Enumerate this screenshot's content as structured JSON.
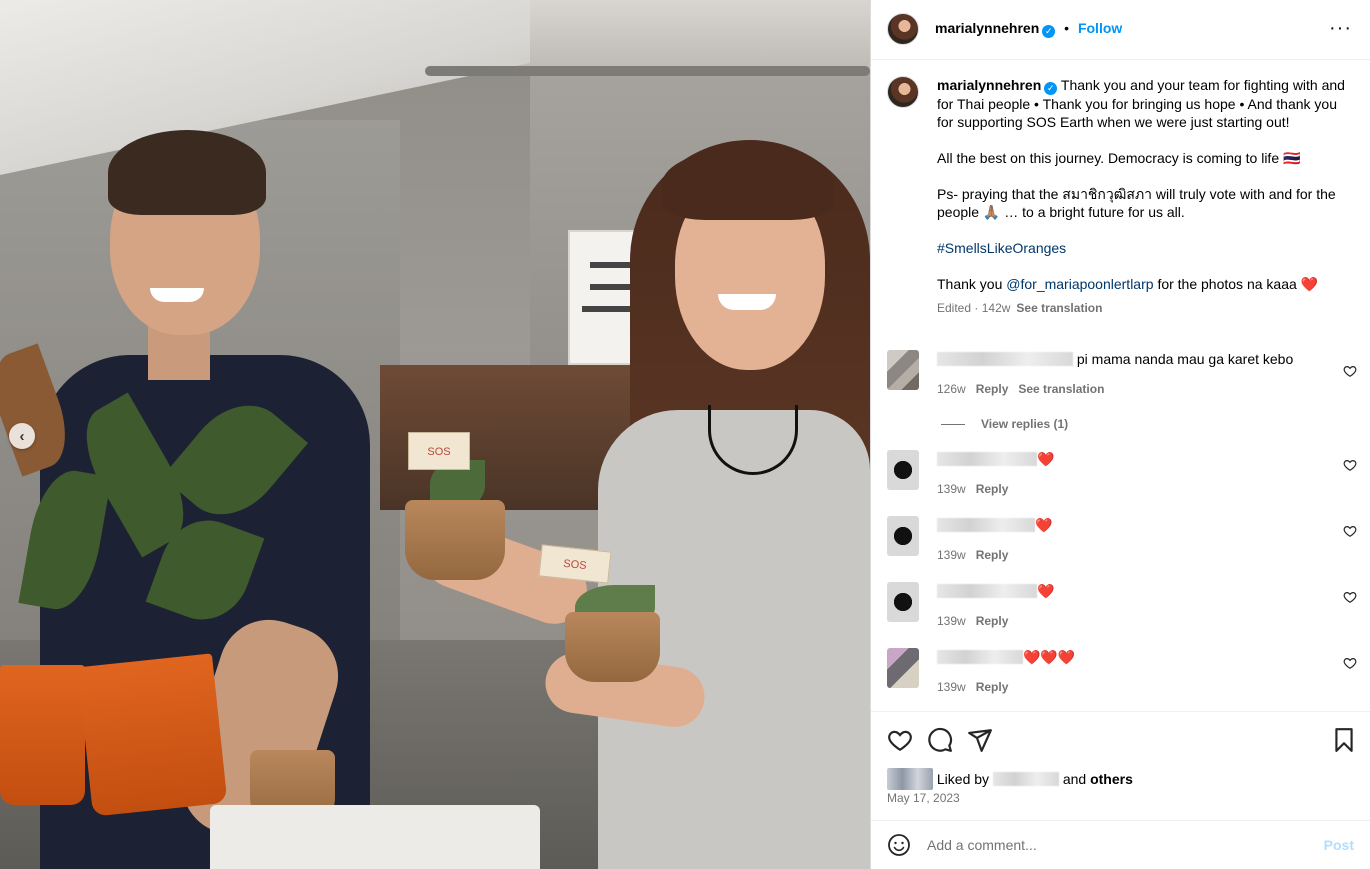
{
  "header": {
    "username": "marialynnehren",
    "verified": true,
    "separator": "•",
    "follow_label": "Follow",
    "more_icon": "more-horizontal-icon"
  },
  "caption": {
    "username": "marialynnehren",
    "text_1": "Thank you and your team for fighting with and for Thai people • Thank you for bringing us hope • And thank you for supporting SOS Earth when we were just starting out!",
    "text_2": "All the best on this journey. Democracy is coming to life 🇹🇭",
    "text_3": "Ps- praying that the สมาชิกวุฒิสภา will truly vote with and for the people 🙏🏽 … to a bright future for us all.",
    "hashtag": "#SmellsLikeOranges",
    "text_4_prefix": "Thank you",
    "mention": "@for_mariapoonlertlarp",
    "text_4_suffix": "for the photos na kaaa ❤️",
    "edited": "Edited",
    "time": "142w",
    "see_translation": "See translation",
    "dot": "·"
  },
  "comments": [
    {
      "text": "pi mama nanda mau ga karet kebo",
      "time": "126w",
      "reply": "Reply",
      "see_translation": "See translation"
    },
    {
      "text": "❤️",
      "time": "139w",
      "reply": "Reply"
    },
    {
      "text": "❤️",
      "time": "139w",
      "reply": "Reply"
    },
    {
      "text": "❤️",
      "time": "139w",
      "reply": "Reply"
    },
    {
      "text": "❤️❤️❤️",
      "time": "139w",
      "reply": "Reply"
    }
  ],
  "view_replies": "View replies (1)",
  "actions": {
    "liked_by": "Liked by",
    "and": "and",
    "others": "others",
    "date": "May 17, 2023"
  },
  "add_comment": {
    "placeholder": "Add a comment...",
    "post_label": "Post"
  },
  "photo": {
    "sign_pot_label": "SOS",
    "carousel_prev_icon": "chevron-left-icon"
  },
  "colors": {
    "link": "#00376b",
    "follow": "#0095f6",
    "heart": "#ed4956",
    "muted": "#737373"
  }
}
